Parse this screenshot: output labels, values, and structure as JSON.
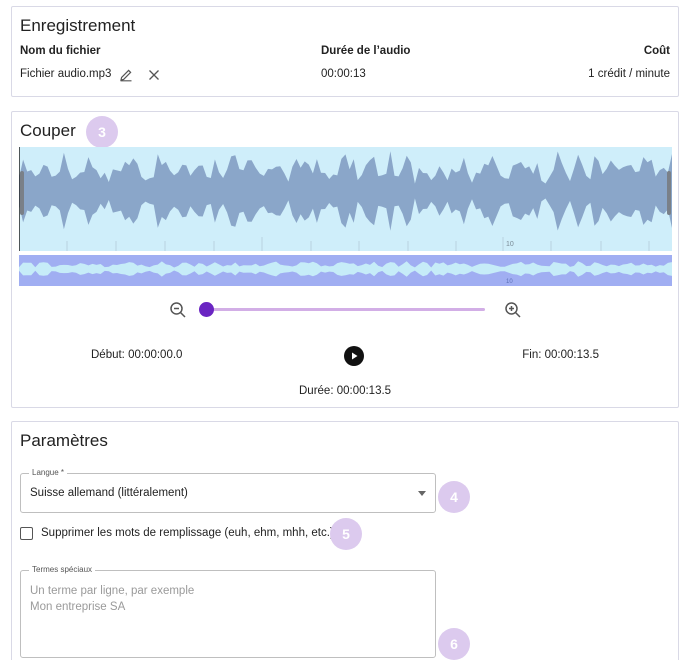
{
  "recording": {
    "title": "Enregistrement",
    "col_filename": "Nom du fichier",
    "col_duration": "Durée de l’audio",
    "col_cost": "Coût",
    "filename": "Fichier audio.mp3",
    "duration": "00:00:13",
    "cost": "1 crédit / minute",
    "edit_icon": "pencil-icon",
    "remove_icon": "close-icon"
  },
  "cut": {
    "title": "Couper",
    "badge": "3",
    "tick_label": "10",
    "mini_tick_label": "10",
    "zoom_out_icon": "zoom-out-icon",
    "zoom_in_icon": "zoom-in-icon",
    "zoom_level": 0,
    "start_label": "Début: 00:00:00.0",
    "end_label": "Fin: 00:00:13.5",
    "duration_label": "Durée: 00:00:13.5",
    "play_icon": "play-icon",
    "colors": {
      "wave_bg": "#cfeefa",
      "wave_fill": "#8aa6c9",
      "mini_bg": "#a0aef2",
      "mini_wave": "#c6ecf8",
      "slider": "#6a25c2"
    }
  },
  "params": {
    "title": "Paramètres",
    "language_label": "Langue *",
    "language_value": "Suisse allemand (littéralement)",
    "badge_language": "4",
    "filler_label": "Supprimer les mots de remplissage (euh, ehm, mhh, etc.)",
    "filler_checked": false,
    "badge_filler": "5",
    "terms_label": "Termes spéciaux",
    "terms_placeholder_1": "Un terme par ligne, par exemple",
    "terms_placeholder_2": "Mon entreprise SA",
    "badge_terms": "6"
  }
}
